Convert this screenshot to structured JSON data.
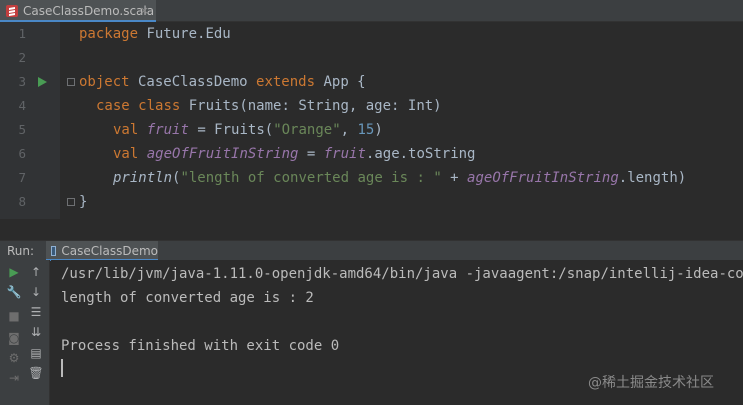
{
  "editor_tab": {
    "label": "CaseClassDemo.scala",
    "close": "×"
  },
  "gutter": {
    "line_numbers": [
      "1",
      "2",
      "3",
      "4",
      "5",
      "6",
      "7",
      "8"
    ]
  },
  "code": {
    "l1": {
      "kw": "package",
      "rest": " Future.Edu"
    },
    "l3": {
      "kw1": "object",
      "name": " CaseClassDemo ",
      "kw2": "extends",
      "rest": " App {"
    },
    "l4": {
      "kw1": "case",
      "sp": " ",
      "kw2": "class",
      "rest": " Fruits(name: String, age: Int)"
    },
    "l5": {
      "kw": "val",
      "sp": " ",
      "var": "fruit",
      "mid": " = Fruits(",
      "str": "\"Orange\"",
      "comma": ", ",
      "num": "15",
      "end": ")"
    },
    "l6": {
      "kw": "val",
      "sp": " ",
      "var": "ageOfFruitInString",
      "mid": " = ",
      "var2": "fruit",
      "end": ".age.toString"
    },
    "l7": {
      "fn": "println",
      "open": "(",
      "str": "\"length of converted age is : \"",
      "plus": " + ",
      "var": "ageOfFruitInString",
      "end": ".length)"
    },
    "l8": {
      "text": "}"
    }
  },
  "run_window": {
    "title": "Run:",
    "tab_label": "CaseClassDemo",
    "console": [
      "/usr/lib/jvm/java-1.11.0-openjdk-amd64/bin/java -javaagent:/snap/intellij-idea-co",
      "length of converted age is : 2",
      "",
      "Process finished with exit code 0"
    ]
  },
  "toolbar_icons": {
    "rerun": "▶",
    "up": "↑",
    "wrench": "🔧",
    "down": "↓",
    "stop": "■",
    "wrap": "☰",
    "camera": "◙",
    "scroll_end": "⇊",
    "gear": "⚙",
    "print": "▤",
    "exit": "⇥",
    "trash": "🗑"
  },
  "watermark": "@稀土掘金技术社区",
  "colors": {
    "keyword": "#cc7832",
    "string": "#6a8759",
    "number": "#6897bb",
    "field": "#9876aa",
    "text": "#a9b7c6",
    "run_green": "#499c54"
  }
}
